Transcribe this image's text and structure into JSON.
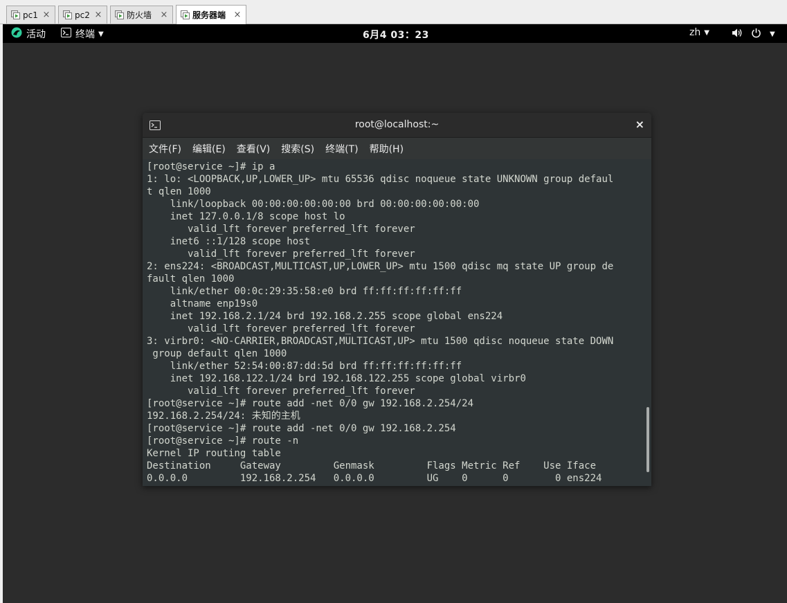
{
  "vmware": {
    "tabs": [
      {
        "label": "pc1",
        "close": "×"
      },
      {
        "label": "pc2",
        "close": "×"
      },
      {
        "label": "防火墙",
        "close": "×"
      },
      {
        "label": "服务器端",
        "close": "×"
      }
    ]
  },
  "gnome": {
    "activities_label": "活动",
    "app_menu_label": "终端",
    "clock": "6月4 03：23",
    "language": "zh"
  },
  "terminal": {
    "window_title": "root@localhost:~",
    "close_glyph": "×",
    "menus": [
      "文件(F)",
      "编辑(E)",
      "查看(V)",
      "搜索(S)",
      "终端(T)",
      "帮助(H)"
    ],
    "lines": [
      "[root@service ~]# ip a",
      "1: lo: <LOOPBACK,UP,LOWER_UP> mtu 65536 qdisc noqueue state UNKNOWN group defaul",
      "t qlen 1000",
      "    link/loopback 00:00:00:00:00:00 brd 00:00:00:00:00:00",
      "    inet 127.0.0.1/8 scope host lo",
      "       valid_lft forever preferred_lft forever",
      "    inet6 ::1/128 scope host",
      "       valid_lft forever preferred_lft forever",
      "2: ens224: <BROADCAST,MULTICAST,UP,LOWER_UP> mtu 1500 qdisc mq state UP group de",
      "fault qlen 1000",
      "    link/ether 00:0c:29:35:58:e0 brd ff:ff:ff:ff:ff:ff",
      "    altname enp19s0",
      "    inet 192.168.2.1/24 brd 192.168.2.255 scope global ens224",
      "       valid_lft forever preferred_lft forever",
      "3: virbr0: <NO-CARRIER,BROADCAST,MULTICAST,UP> mtu 1500 qdisc noqueue state DOWN",
      " group default qlen 1000",
      "    link/ether 52:54:00:87:dd:5d brd ff:ff:ff:ff:ff:ff",
      "    inet 192.168.122.1/24 brd 192.168.122.255 scope global virbr0",
      "       valid_lft forever preferred_lft forever",
      "[root@service ~]# route add -net 0/0 gw 192.168.2.254/24",
      "192.168.2.254/24: 未知的主机",
      "[root@service ~]# route add -net 0/0 gw 192.168.2.254",
      "[root@service ~]# route -n",
      "Kernel IP routing table",
      "Destination     Gateway         Genmask         Flags Metric Ref    Use Iface",
      "0.0.0.0         192.168.2.254   0.0.0.0         UG    0      0        0 ens224"
    ]
  }
}
